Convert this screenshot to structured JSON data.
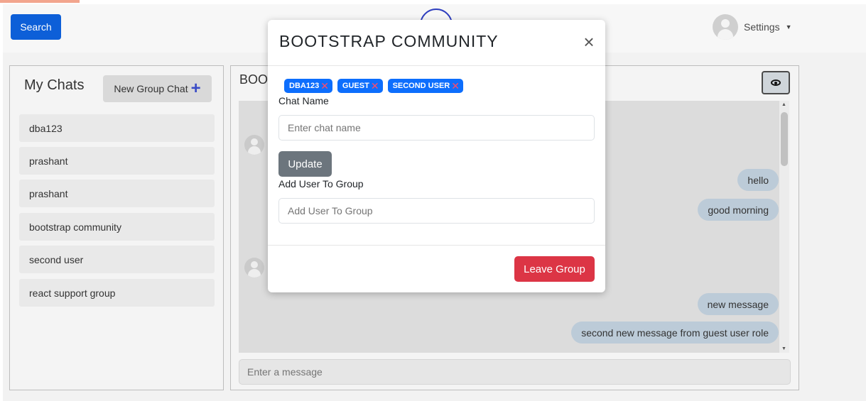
{
  "header": {
    "search_label": "Search",
    "settings_label": "Settings"
  },
  "chats": {
    "title": "My Chats",
    "new_group_label": "New Group Chat",
    "items": [
      {
        "label": "dba123"
      },
      {
        "label": "prashant"
      },
      {
        "label": "prashant"
      },
      {
        "label": "bootstrap community"
      },
      {
        "label": "second user"
      },
      {
        "label": "react support group"
      }
    ]
  },
  "conversation": {
    "title": "BOOTSTRAP COMMUNITY",
    "messages": [
      {
        "text": "hello",
        "own": true
      },
      {
        "text": "good morning",
        "own": true
      },
      {
        "text": "new message",
        "own": true
      },
      {
        "text": "second new message from guest user role",
        "own": true
      }
    ],
    "input_placeholder": "Enter a message"
  },
  "modal": {
    "title": "BOOTSTRAP COMMUNITY",
    "members": [
      {
        "label": "DBA123"
      },
      {
        "label": "GUEST"
      },
      {
        "label": "SECOND USER"
      }
    ],
    "chat_name_label": "Chat Name",
    "chat_name_placeholder": "Enter chat name",
    "update_label": "Update",
    "add_user_label": "Add User To Group",
    "add_user_placeholder": "Add User To Group",
    "leave_label": "Leave Group",
    "close_glyph": "×"
  },
  "colors": {
    "primary": "#0d5fd8",
    "badge": "#0d6efd",
    "danger": "#dc3545",
    "secondary": "#6c757d",
    "bubble": "#bccbd8"
  }
}
